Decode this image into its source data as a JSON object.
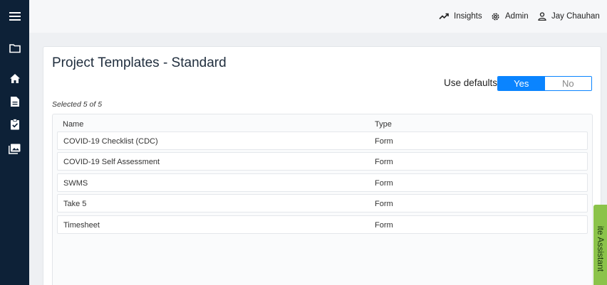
{
  "sidebar": {
    "icons": [
      "menu-icon",
      "folder-icon",
      "home-icon",
      "document-icon",
      "clipboard-check-icon",
      "gallery-icon"
    ]
  },
  "header": {
    "insights_label": "Insights",
    "admin_label": "Admin",
    "user_name": "Jay Chauhan"
  },
  "page": {
    "title": "Project Templates - Standard",
    "use_defaults_label": "Use defaults",
    "toggle_yes": "Yes",
    "toggle_no": "No",
    "toggle_selected": "Yes",
    "selected_info": "Selected 5 of 5"
  },
  "table": {
    "columns": [
      "Name",
      "Type"
    ],
    "rows": [
      {
        "name": "COVID-19 Checklist (CDC)",
        "type": "Form"
      },
      {
        "name": "COVID-19 Self Assessment",
        "type": "Form"
      },
      {
        "name": "SWMS",
        "type": "Form"
      },
      {
        "name": "Take 5",
        "type": "Form"
      },
      {
        "name": "Timesheet",
        "type": "Form"
      }
    ]
  },
  "assistant": {
    "label": "ite Assistant"
  },
  "colors": {
    "sidebar_bg": "#0d2137",
    "toggle_active": "#0a84ff",
    "assistant_tab": "#8bc34a"
  }
}
